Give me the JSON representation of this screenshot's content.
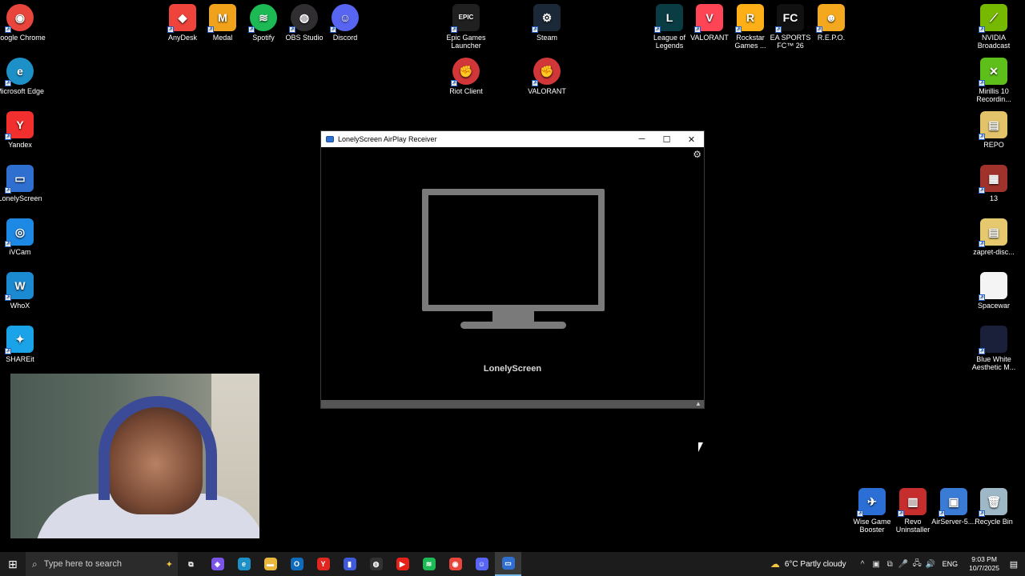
{
  "desktop_icons": [
    {
      "label": "Google Chrome",
      "color": "#e8453c",
      "glyph": "◉"
    },
    {
      "label": "Microsoft Edge",
      "color": "#1e90c8",
      "glyph": "e"
    },
    {
      "label": "Yandex",
      "color": "#f12f2f",
      "glyph": "Y"
    },
    {
      "label": "LonelyScreen",
      "color": "#2f6fd0",
      "glyph": "▭"
    },
    {
      "label": "iVCam",
      "color": "#1e88e5",
      "glyph": "◎"
    },
    {
      "label": "WhoX",
      "color": "#1c8ad1",
      "glyph": "W"
    },
    {
      "label": "SHAREit",
      "color": "#1aa3e8",
      "glyph": "✦"
    },
    {
      "label": "AnyDesk",
      "color": "#ef443b",
      "glyph": "◆"
    },
    {
      "label": "Medal",
      "color": "#f0a21b",
      "glyph": "M"
    },
    {
      "label": "Spotify",
      "color": "#1db954",
      "glyph": "≋"
    },
    {
      "label": "OBS Studio",
      "color": "#302e31",
      "glyph": "◍"
    },
    {
      "label": "Discord",
      "color": "#5865f2",
      "glyph": "☺"
    },
    {
      "label": "Epic Games Launcher",
      "color": "#202020",
      "glyph": "EPIC"
    },
    {
      "label": "Riot Client",
      "color": "#d13639",
      "glyph": "✊"
    },
    {
      "label": "Steam",
      "color": "#1b2838",
      "glyph": "⚙"
    },
    {
      "label": "VALORANT",
      "color": "#d13639",
      "glyph": "✊"
    },
    {
      "label": "League of Legends",
      "color": "#0a3c44",
      "glyph": "L"
    },
    {
      "label": "VALORANT",
      "color": "#fd4556",
      "glyph": "V"
    },
    {
      "label": "Rockstar Games ...",
      "color": "#fcaf17",
      "glyph": "R"
    },
    {
      "label": "EA SPORTS FC™ 26",
      "color": "#111111",
      "glyph": "FC"
    },
    {
      "label": "R.E.P.O.",
      "color": "#f4a81d",
      "glyph": "☻"
    },
    {
      "label": "NVIDIA Broadcast",
      "color": "#76b900",
      "glyph": "⟋"
    },
    {
      "label": "Mirillis 10 Recordin...",
      "color": "#5fbf1a",
      "glyph": "✕"
    },
    {
      "label": "REPO",
      "color": "#e3c36a",
      "glyph": "▤"
    },
    {
      "label": "13",
      "color": "#a0322c",
      "glyph": "▦"
    },
    {
      "label": "zapret-disc...",
      "color": "#e6c96f",
      "glyph": "▤"
    },
    {
      "label": "Spacewar",
      "color": "#f4f4f4",
      "glyph": ""
    },
    {
      "label": "Blue White Aesthetic M...",
      "color": "#1a1f3a",
      "glyph": ""
    },
    {
      "label": "Wise Game Booster",
      "color": "#2b6fd6",
      "glyph": "✈"
    },
    {
      "label": "Revo Uninstaller",
      "color": "#c62e2e",
      "glyph": "▥"
    },
    {
      "label": "AirServer-5....",
      "color": "#3a7bd5",
      "glyph": "▣"
    },
    {
      "label": "Recycle Bin",
      "color": "#9fb8c8",
      "glyph": "🗑"
    }
  ],
  "window": {
    "title": "LonelyScreen AirPlay Receiver",
    "minimize": "─",
    "maximize": "☐",
    "close": "✕",
    "settings": "⚙",
    "brand": "LonelyScreen",
    "scroll_up": "▲"
  },
  "taskbar": {
    "start": "⊞",
    "search_placeholder": "Type here to search",
    "search_icon": "⌕",
    "search_deco": "✦",
    "apps": [
      {
        "name": "task-view",
        "glyph": "⧉",
        "color": "#1c1c1c"
      },
      {
        "name": "copilot",
        "glyph": "◈",
        "color": "#7b55e8"
      },
      {
        "name": "edge",
        "glyph": "e",
        "color": "#1e90c8"
      },
      {
        "name": "file-explorer",
        "glyph": "▬",
        "color": "#e8b73b"
      },
      {
        "name": "outlook",
        "glyph": "O",
        "color": "#0f6cbd"
      },
      {
        "name": "yandex",
        "glyph": "Y",
        "color": "#e0261f"
      },
      {
        "name": "chart-app",
        "glyph": "▮",
        "color": "#3f5ad8"
      },
      {
        "name": "obs",
        "glyph": "◍",
        "color": "#333333"
      },
      {
        "name": "youtube",
        "glyph": "▶",
        "color": "#e62117"
      },
      {
        "name": "spotify",
        "glyph": "≋",
        "color": "#1db954"
      },
      {
        "name": "chrome",
        "glyph": "◉",
        "color": "#e8453c"
      },
      {
        "name": "discord",
        "glyph": "☺",
        "color": "#5865f2"
      },
      {
        "name": "lonelyscreen",
        "glyph": "▭",
        "color": "#2f6fd0"
      }
    ],
    "weather": "6°C  Partly cloudy",
    "weather_icon": "☁",
    "tray_icons": [
      "^",
      "▣",
      "⧉",
      "🎤",
      "🖧",
      "🔊"
    ],
    "language": "ENG",
    "time": "9:03 PM",
    "date": "10/7/2025",
    "notifications": "▤"
  }
}
